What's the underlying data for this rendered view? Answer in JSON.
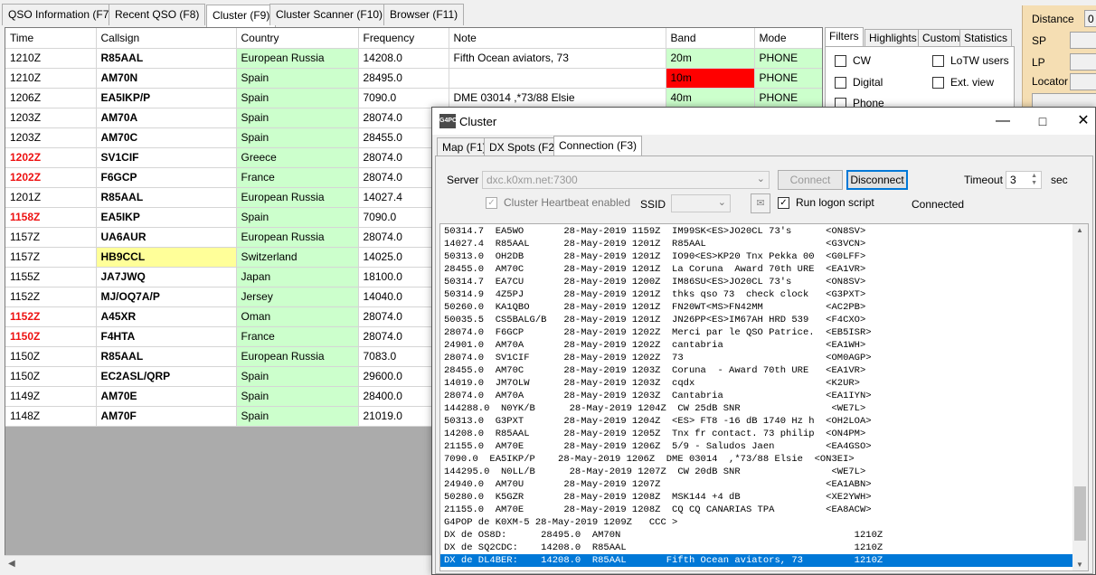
{
  "top_tabs": [
    "QSO Information (F7)",
    "Recent QSO (F8)",
    "Cluster (F9)",
    "Cluster Scanner (F10)",
    "Browser (F11)"
  ],
  "grid": {
    "headers": [
      "Time",
      "Callsign",
      "Country",
      "Frequency",
      "Note",
      "Band",
      "Mode"
    ],
    "rows": [
      {
        "time": "1210Z",
        "call": "R85AAL",
        "country": "European Russia",
        "freq": "14208.0",
        "note": "Fifth Ocean aviators, 73",
        "band": "20m",
        "mode": "PHONE"
      },
      {
        "time": "1210Z",
        "call": "AM70N",
        "country": "Spain",
        "freq": "28495.0",
        "note": "",
        "band": "10m",
        "mode": "PHONE"
      },
      {
        "time": "1206Z",
        "call": "EA5IKP/P",
        "country": "Spain",
        "freq": "7090.0",
        "note": "DME 03014  ,*73/88 Elsie",
        "band": "40m",
        "mode": "PHONE"
      },
      {
        "time": "1203Z",
        "call": "AM70A",
        "country": "Spain",
        "freq": "28074.0",
        "note": "",
        "band": "",
        "mode": ""
      },
      {
        "time": "1203Z",
        "call": "AM70C",
        "country": "Spain",
        "freq": "28455.0",
        "note": "",
        "band": "",
        "mode": ""
      },
      {
        "time": "1202Z",
        "call": "SV1CIF",
        "country": "Greece",
        "freq": "28074.0",
        "note": "",
        "band": "",
        "mode": ""
      },
      {
        "time": "1202Z",
        "call": "F6GCP",
        "country": "France",
        "freq": "28074.0",
        "note": "",
        "band": "",
        "mode": ""
      },
      {
        "time": "1201Z",
        "call": "R85AAL",
        "country": "European Russia",
        "freq": "14027.4",
        "note": "",
        "band": "",
        "mode": ""
      },
      {
        "time": "1158Z",
        "call": "EA5IKP",
        "country": "Spain",
        "freq": "7090.0",
        "note": "",
        "band": "",
        "mode": ""
      },
      {
        "time": "1157Z",
        "call": "UA6AUR",
        "country": "European Russia",
        "freq": "28074.0",
        "note": "",
        "band": "",
        "mode": ""
      },
      {
        "time": "1157Z",
        "call": "HB9CCL",
        "country": "Switzerland",
        "freq": "14025.0",
        "note": "",
        "band": "",
        "mode": ""
      },
      {
        "time": "1155Z",
        "call": "JA7JWQ",
        "country": "Japan",
        "freq": "18100.0",
        "note": "",
        "band": "",
        "mode": ""
      },
      {
        "time": "1152Z",
        "call": "MJ/OQ7A/P",
        "country": "Jersey",
        "freq": "14040.0",
        "note": "",
        "band": "",
        "mode": ""
      },
      {
        "time": "1152Z",
        "call": "A45XR",
        "country": "Oman",
        "freq": "28074.0",
        "note": "",
        "band": "",
        "mode": ""
      },
      {
        "time": "1150Z",
        "call": "F4HTA",
        "country": "France",
        "freq": "28074.0",
        "note": "",
        "band": "",
        "mode": ""
      },
      {
        "time": "1150Z",
        "call": "R85AAL",
        "country": "European Russia",
        "freq": "7083.0",
        "note": "",
        "band": "",
        "mode": ""
      },
      {
        "time": "1150Z",
        "call": "EC2ASL/QRP",
        "country": "Spain",
        "freq": "29600.0",
        "note": "",
        "band": "",
        "mode": ""
      },
      {
        "time": "1149Z",
        "call": "AM70E",
        "country": "Spain",
        "freq": "28400.0",
        "note": "",
        "band": "",
        "mode": ""
      },
      {
        "time": "1148Z",
        "call": "AM70F",
        "country": "Spain",
        "freq": "21019.0",
        "note": "",
        "band": "",
        "mode": ""
      }
    ],
    "red_times": [
      5,
      6,
      8,
      13,
      14
    ],
    "highlight_call": 10,
    "red_band": 1
  },
  "filters": {
    "tabs": [
      "Filters",
      "Highlights",
      "Custom",
      "Statistics"
    ],
    "checks": [
      "CW",
      "LoTW users",
      "Digital",
      "Ext. view",
      "Phone"
    ]
  },
  "dist": {
    "labels": [
      "Distance",
      "SP",
      "LP",
      "Locator"
    ],
    "distance_value": "0"
  },
  "cluster": {
    "title": "Cluster",
    "icon_text": "G4POP",
    "tabs": [
      "Map (F1)",
      "DX Spots (F2)",
      "Connection (F3)"
    ],
    "server_label": "Server",
    "server_value": "dxc.k0xm.net:7300",
    "connect_label": "Connect",
    "disconnect_label": "Disconnect",
    "timeout_label": "Timeout",
    "timeout_value": "3",
    "sec_label": "sec",
    "heartbeat_label": "Cluster Heartbeat enabled",
    "ssid_label": "SSID",
    "logon_label": "Run logon script",
    "status": "Connected",
    "log": [
      "50314.7  EA5WO       28-May-2019 1159Z  IM99SK<ES>JO20CL 73's      <ON8SV>",
      "14027.4  R85AAL      28-May-2019 1201Z  R85AAL                     <G3VCN>",
      "50313.0  OH2DB       28-May-2019 1201Z  IO90<ES>KP20 Tnx Pekka 00  <G0LFF>",
      "28455.0  AM70C       28-May-2019 1201Z  La Coruna  Award 70th URE  <EA1VR>",
      "50314.7  EA7CU       28-May-2019 1200Z  IM86SU<ES>JO20CL 73's      <ON8SV>",
      "50314.9  4Z5PJ       28-May-2019 1201Z  thks qso 73  check clock   <G3PXT>",
      "50260.0  KA1QBO      28-May-2019 1201Z  FN20WT<MS>FN42MM           <AC2PB>",
      "50035.5  CS5BALG/B   28-May-2019 1201Z  JN26PP<ES>IM67AH HRD 539   <F4CXO>",
      "28074.0  F6GCP       28-May-2019 1202Z  Merci par le QSO Patrice.  <EB5ISR>",
      "24901.0  AM70A       28-May-2019 1202Z  cantabria                  <EA1WH>",
      "28074.0  SV1CIF      28-May-2019 1202Z  73                         <OM0AGP>",
      "28455.0  AM70C       28-May-2019 1203Z  Coruna  - Award 70th URE   <EA1VR>",
      "14019.0  JM7OLW      28-May-2019 1203Z  cqdx                       <K2UR>",
      "28074.0  AM70A       28-May-2019 1203Z  Cantabria                  <EA1IYN>",
      "144288.0  N0YK/B      28-May-2019 1204Z  CW 25dB SNR                <WE7L>",
      "50313.0  G3PXT       28-May-2019 1204Z  <ES> FT8 -16 dB 1740 Hz h  <OH2LOA>",
      "14208.0  R85AAL      28-May-2019 1205Z  Tnx fr contact. 73 philip  <ON4PM>",
      "21155.0  AM70E       28-May-2019 1206Z  5/9 - Saludos Jaen         <EA4GSO>",
      "7090.0  EA5IKP/P    28-May-2019 1206Z  DME 03014  ,*73/88 Elsie  <ON3EI>",
      "144295.0  N0LL/B      28-May-2019 1207Z  CW 20dB SNR                <WE7L>",
      "24940.0  AM70U       28-May-2019 1207Z                             <EA1ABN>",
      "50280.0  K5GZR       28-May-2019 1208Z  MSK144 +4 dB               <XE2YWH>",
      "21155.0  AM70E       28-May-2019 1208Z  CQ CQ CANARIAS TPA         <EA8ACW>",
      "G4POP de K0XM-5 28-May-2019 1209Z   CCC >",
      "DX de OS8D:      28495.0  AM70N                                         1210Z",
      "DX de SQ2CDC:    14208.0  R85AAL                                        1210Z",
      "DX de DL4BER:    14208.0  R85AAL       Fifth Ocean aviators, 73         1210Z"
    ],
    "selected_line": 26
  }
}
